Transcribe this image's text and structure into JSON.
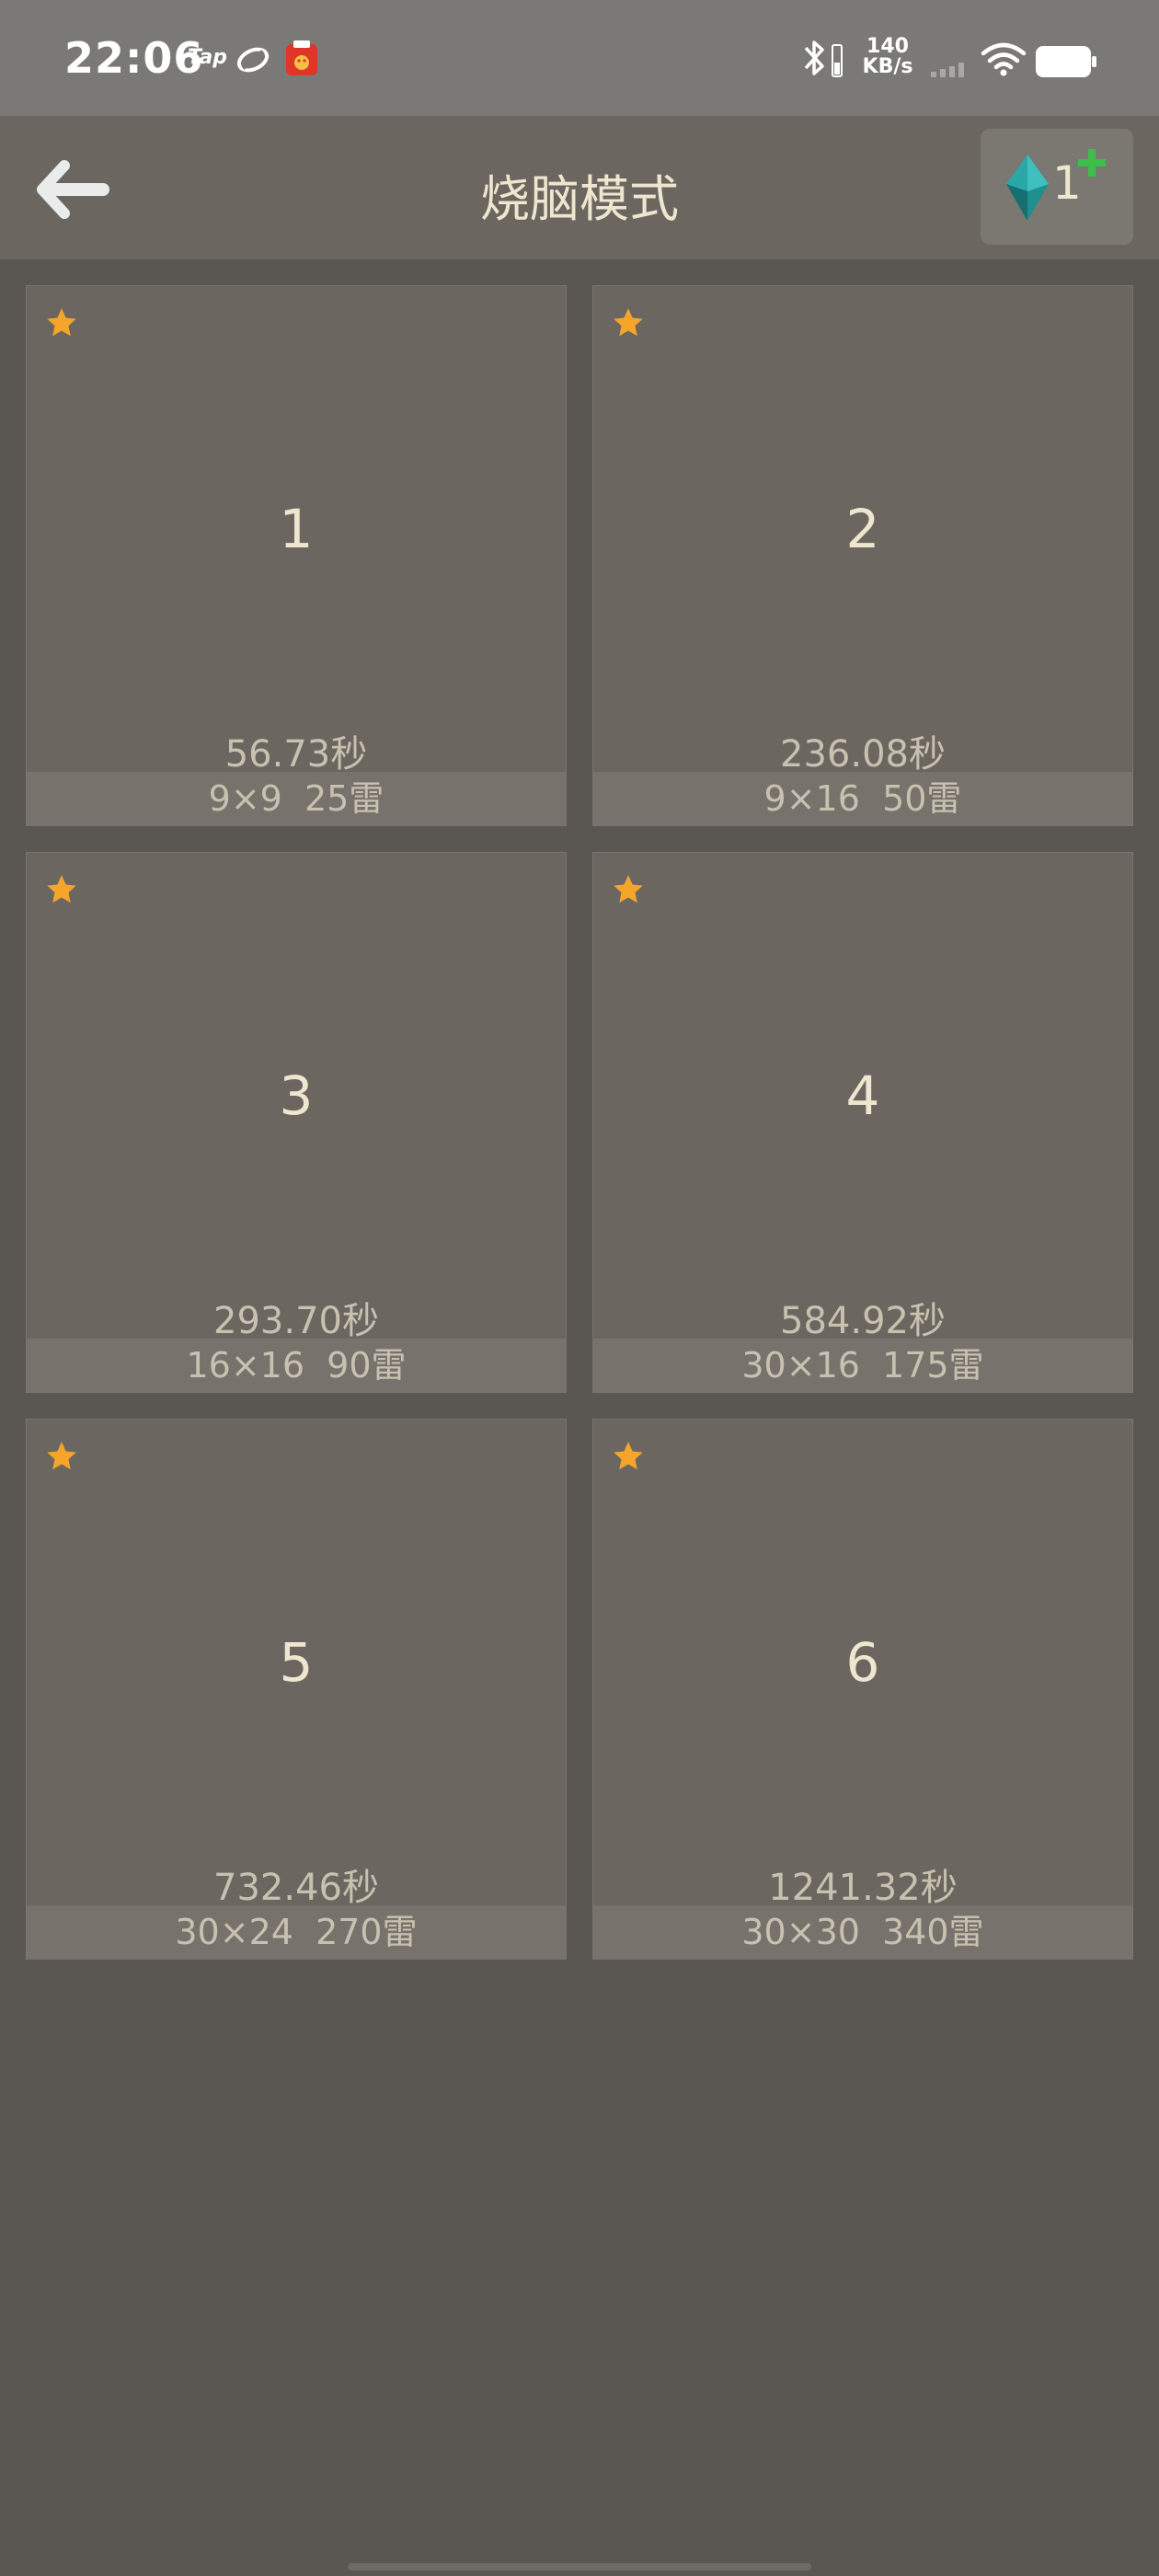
{
  "status_bar": {
    "time": "22:06",
    "tap_label": "Tap",
    "speed_value": "140",
    "speed_unit": "KB/s"
  },
  "header": {
    "title": "烧脑模式",
    "gem_count": "1"
  },
  "colors": {
    "star": "#f4a52a",
    "gem": "#2ba6a6",
    "plus": "#3bbf4a"
  },
  "levels": [
    {
      "number": "1",
      "best_time": "56.73秒",
      "info": "9×9  25雷"
    },
    {
      "number": "2",
      "best_time": "236.08秒",
      "info": "9×16  50雷"
    },
    {
      "number": "3",
      "best_time": "293.70秒",
      "info": "16×16  90雷"
    },
    {
      "number": "4",
      "best_time": "584.92秒",
      "info": "30×16  175雷"
    },
    {
      "number": "5",
      "best_time": "732.46秒",
      "info": "30×24  270雷"
    },
    {
      "number": "6",
      "best_time": "1241.32秒",
      "info": "30×30  340雷"
    }
  ]
}
